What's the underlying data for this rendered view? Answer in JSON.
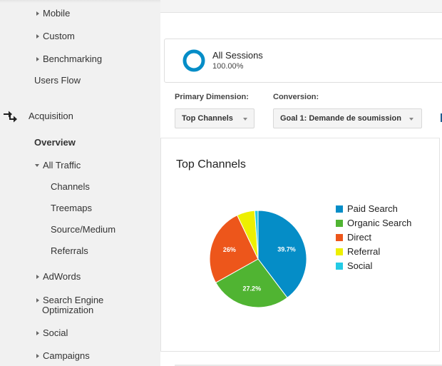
{
  "sidebar": {
    "items": [
      {
        "label": "Mobile",
        "indicator": "collapsed"
      },
      {
        "label": "Custom",
        "indicator": "collapsed"
      },
      {
        "label": "Benchmarking",
        "indicator": "collapsed"
      },
      {
        "label": "Users Flow",
        "indicator": "none"
      },
      {
        "label": "Acquisition",
        "icon": "acquisition-arrows-icon"
      },
      {
        "label": "Overview",
        "active": true
      },
      {
        "label": "All Traffic",
        "indicator": "expanded"
      },
      {
        "label": "Channels"
      },
      {
        "label": "Treemaps"
      },
      {
        "label": "Source/Medium"
      },
      {
        "label": "Referrals"
      },
      {
        "label": "AdWords",
        "indicator": "collapsed"
      },
      {
        "label": "Search Engine",
        "label_line2": "Optimization",
        "indicator": "collapsed"
      },
      {
        "label": "Social",
        "indicator": "collapsed"
      },
      {
        "label": "Campaigns",
        "indicator": "collapsed"
      }
    ]
  },
  "segment": {
    "title": "All Sessions",
    "percent": "100.00%",
    "color": "#058dc7"
  },
  "controls": {
    "primary_dimension_label": "Primary Dimension:",
    "primary_dimension_value": "Top Channels",
    "conversion_label": "Conversion:",
    "conversion_value": "Goal 1: Demande de soumission"
  },
  "chart_data": {
    "type": "pie",
    "title": "Top Channels",
    "legend_position": "right",
    "categories": [
      "Paid Search",
      "Organic Search",
      "Direct",
      "Referral",
      "Social"
    ],
    "values": [
      39.7,
      27.2,
      26.0,
      6.0,
      1.1
    ],
    "data_labels": [
      "39.7%",
      "27.2%",
      "26%",
      "",
      ""
    ],
    "colors": [
      "#058dc7",
      "#50b432",
      "#ed561b",
      "#edef00",
      "#24cbe5"
    ]
  }
}
